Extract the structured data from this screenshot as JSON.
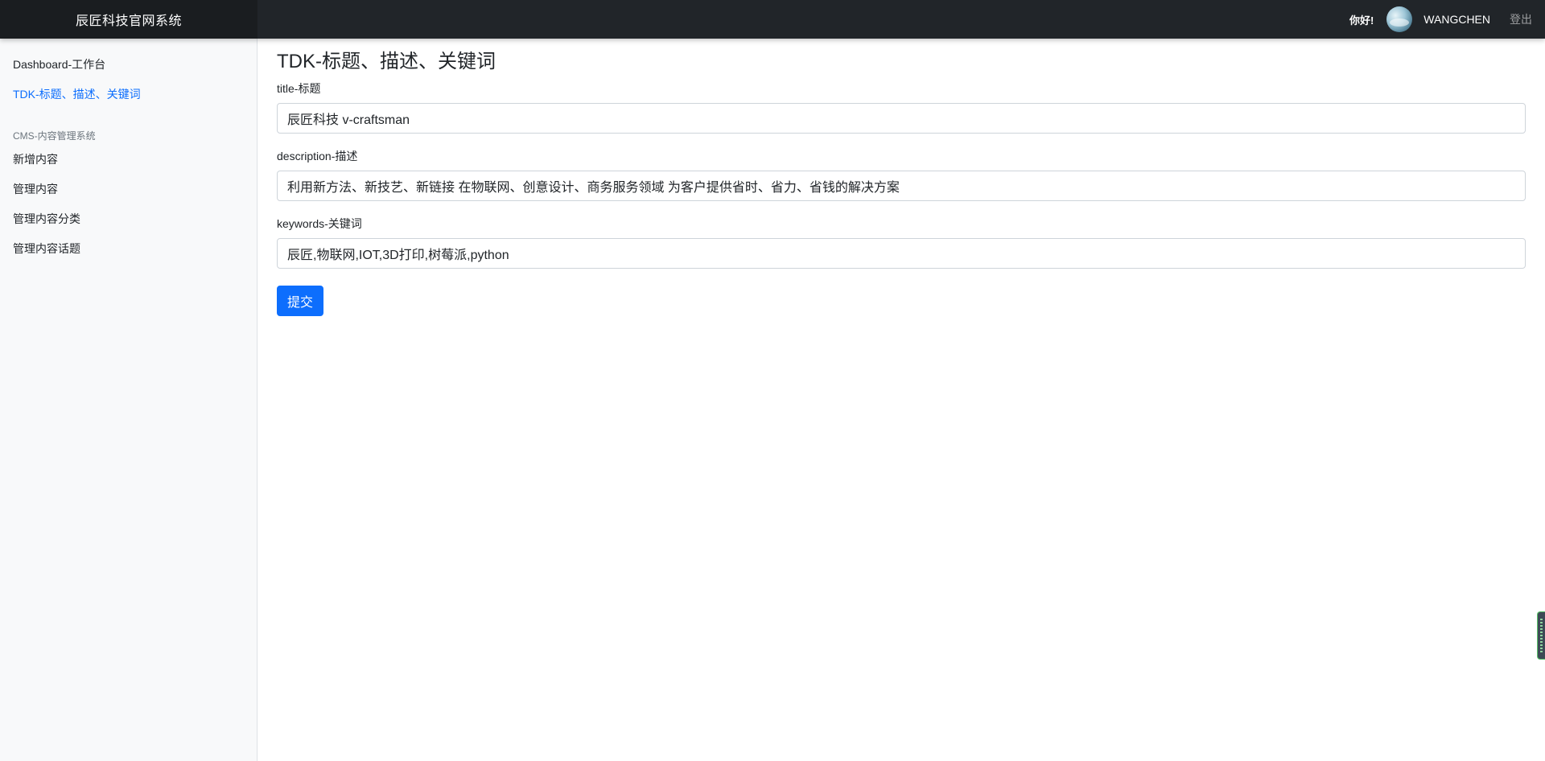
{
  "navbar": {
    "brand": "辰匠科技官网系统",
    "greeting": "你好!",
    "username": "WANGCHEN",
    "logout": "登出"
  },
  "sidebar": {
    "items": [
      {
        "label": "Dashboard-工作台"
      },
      {
        "label": "TDK-标题、描述、关键词"
      }
    ],
    "section_heading": "CMS-内容管理系统",
    "cms_items": [
      {
        "label": "新增内容"
      },
      {
        "label": "管理内容"
      },
      {
        "label": "管理内容分类"
      },
      {
        "label": "管理内容话题"
      }
    ]
  },
  "main": {
    "title": "TDK-标题、描述、关键词",
    "fields": {
      "title": {
        "label": "title-标题",
        "value": "辰匠科技 v-craftsman"
      },
      "description": {
        "label": "description-描述",
        "value": "利用新方法、新技艺、新链接 在物联网、创意设计、商务服务领域 为客户提供省时、省力、省钱的解决方案"
      },
      "keywords": {
        "label": "keywords-关键词",
        "value": "辰匠,物联网,IOT,3D打印,树莓派,python"
      }
    },
    "submit_label": "提交"
  },
  "colors": {
    "navbar_bg": "#212529",
    "primary": "#0d6efd",
    "sidebar_bg": "#f8f9fa"
  }
}
